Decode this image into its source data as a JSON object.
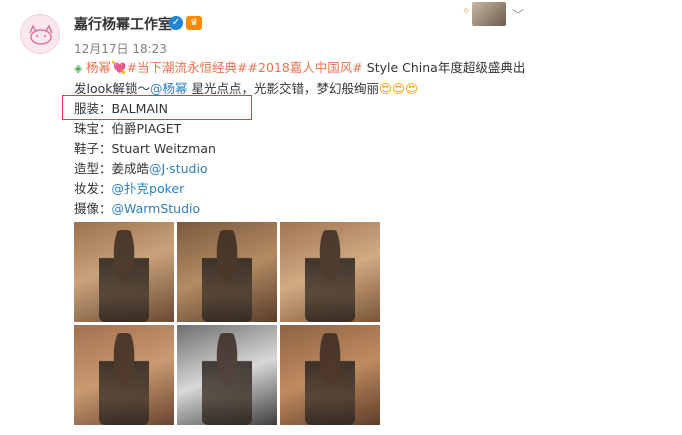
{
  "post": {
    "username": "嘉行杨幂工作室",
    "verified_icon": "verified-badge-icon",
    "member_icon": "vip-member-icon",
    "timestamp": "12月17日 18:23",
    "lines": {
      "l1_prefix": "杨幂",
      "l1_topic1": "#当下潮流永恒经典#",
      "l1_topic2": "#2018嘉人中国风#",
      "l1_rest": " Style China年度超级盛典出",
      "l2_prefix": "发look解锁～",
      "l2_mention": "@杨幂",
      "l2_rest": " 星光点点，光影交错，梦幻般绚丽",
      "l3": "服装：BALMAIN",
      "l4": "珠宝：伯爵PIAGET",
      "l5": "鞋子：Stuart Weitzman",
      "l6_label": "造型：姜成皓",
      "l6_mention": "@J·studio",
      "l7_label": "妆发：",
      "l7_mention": "@扑克poker",
      "l8_label": "摄像：",
      "l8_mention": "@WarmStudio"
    }
  },
  "photos": [
    "photo-1",
    "photo-2",
    "photo-3",
    "photo-4",
    "photo-5",
    "photo-6"
  ],
  "colors": {
    "link": "#eb7350",
    "mention": "#2b7fc0",
    "highlight": "#e23b3b"
  }
}
